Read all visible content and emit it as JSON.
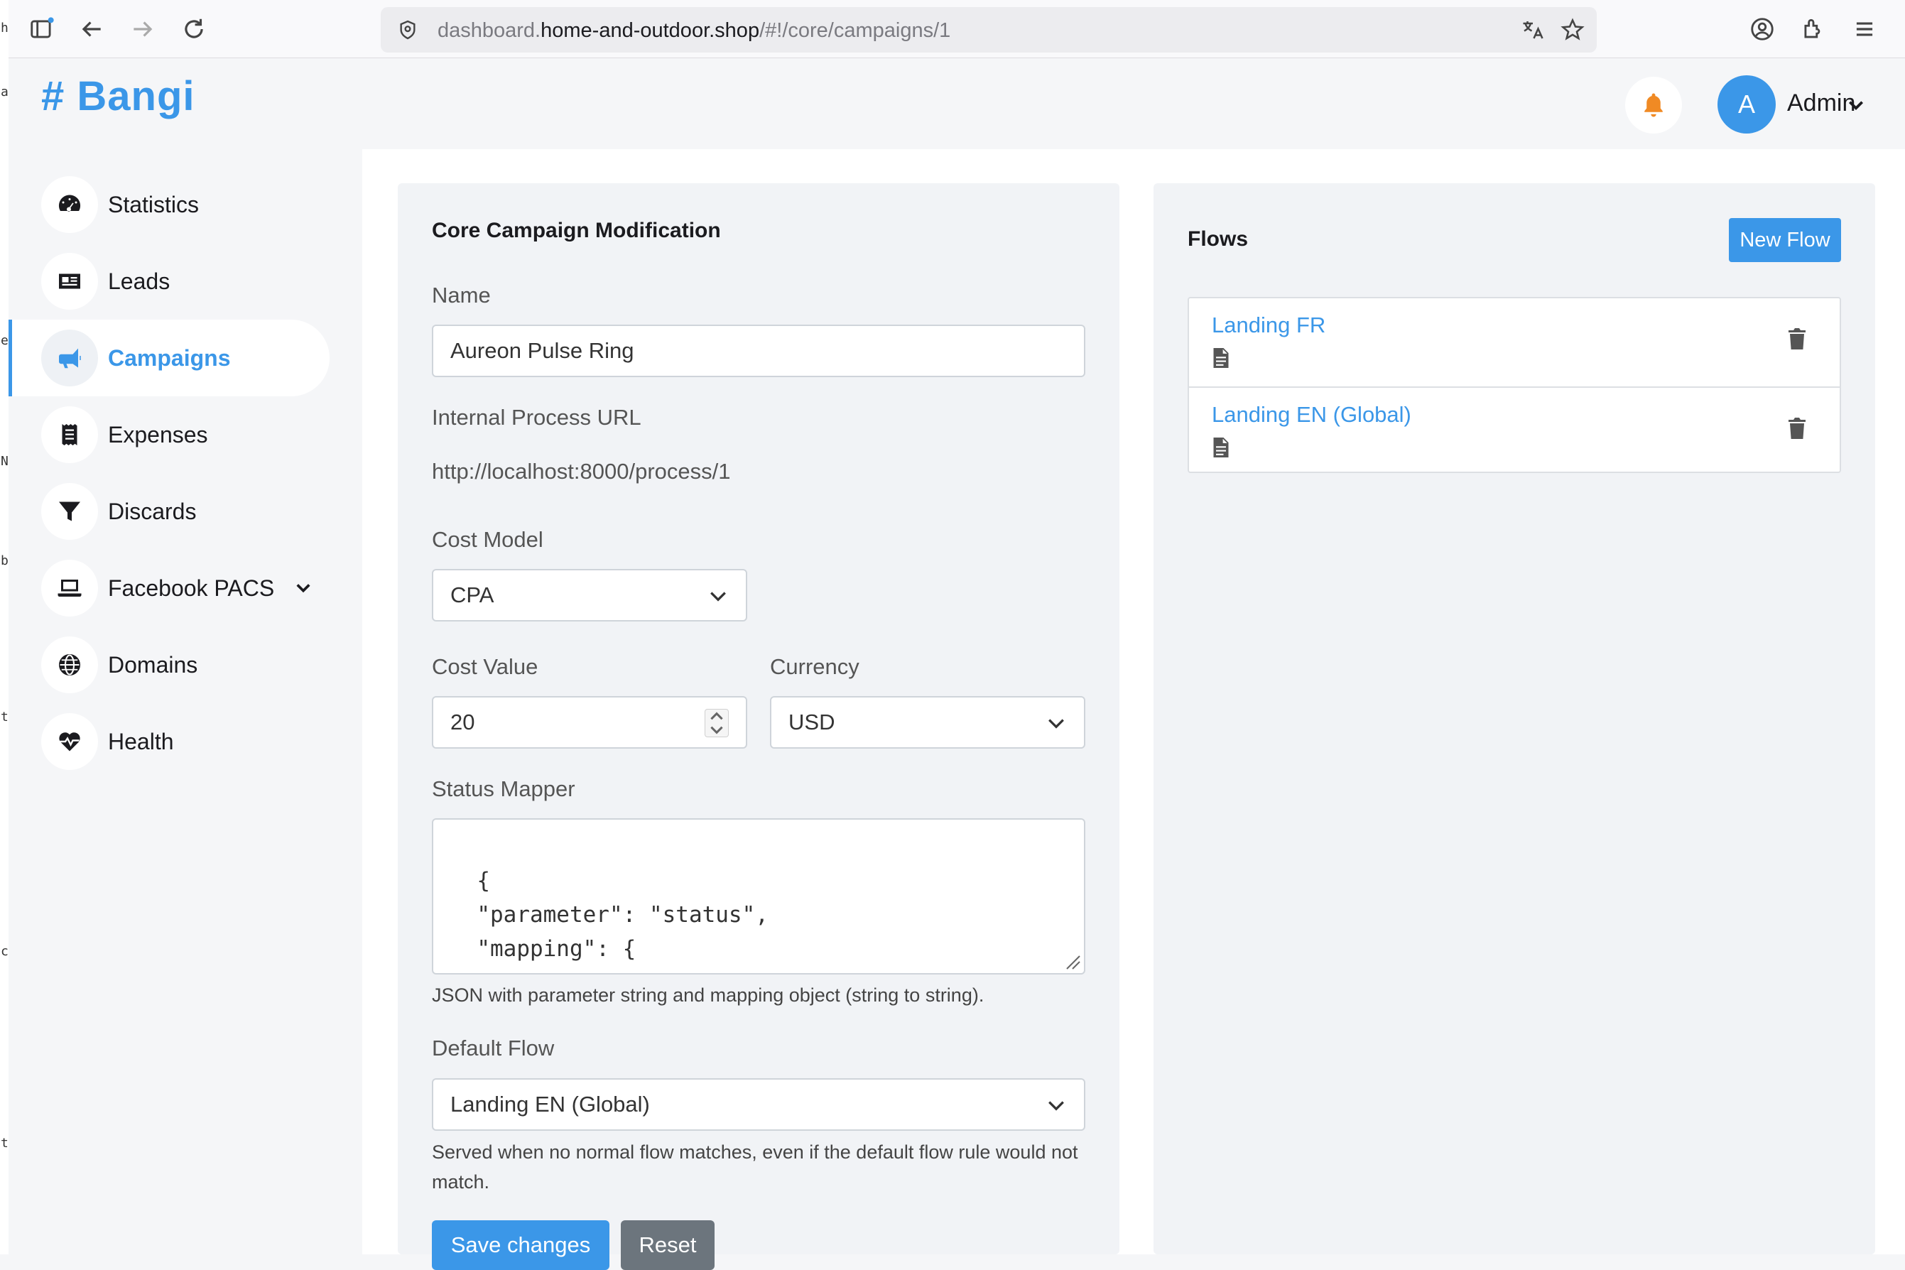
{
  "browser": {
    "url_prefix": "dashboard.",
    "url_host": "home-and-outdoor.shop",
    "url_path": "/#!/core/campaigns/1"
  },
  "brand": {
    "name": "# Bangi",
    "color": "#3b97e8"
  },
  "user": {
    "initial": "A",
    "name": "Admin"
  },
  "sidebar": {
    "items": [
      {
        "label": "Statistics",
        "icon": "gauge-icon"
      },
      {
        "label": "Leads",
        "icon": "id-card-icon"
      },
      {
        "label": "Campaigns",
        "icon": "megaphone-icon",
        "active": true
      },
      {
        "label": "Expenses",
        "icon": "receipt-icon"
      },
      {
        "label": "Discards",
        "icon": "filter-icon"
      },
      {
        "label": "Facebook PACS",
        "icon": "laptop-icon",
        "has_submenu": true
      },
      {
        "label": "Domains",
        "icon": "globe-icon"
      },
      {
        "label": "Health",
        "icon": "heartbeat-icon"
      }
    ]
  },
  "form": {
    "title": "Core Campaign Modification",
    "name_label": "Name",
    "name_value": "Aureon Pulse Ring",
    "url_label": "Internal Process URL",
    "url_value": "http://localhost:8000/process/1",
    "cost_model_label": "Cost Model",
    "cost_model_value": "CPA",
    "cost_value_label": "Cost Value",
    "cost_value": "20",
    "currency_label": "Currency",
    "currency_value": "USD",
    "status_mapper_label": "Status Mapper",
    "status_mapper_value": "{\n  \"parameter\": \"status\",\n  \"mapping\": {\n    \"done\": \"accept\",\n    \"failed\": \"reject\"\n  }\n}",
    "status_mapper_help": "JSON with parameter string and mapping object (string to string).",
    "default_flow_label": "Default Flow",
    "default_flow_value": "Landing EN (Global)",
    "default_flow_help": "Served when no normal flow matches, even if the default flow rule would not match.",
    "save_label": "Save changes",
    "reset_label": "Reset"
  },
  "flows": {
    "title": "Flows",
    "new_label": "New Flow",
    "items": [
      {
        "name": "Landing FR"
      },
      {
        "name": "Landing EN (Global)"
      }
    ]
  },
  "colors": {
    "accent": "#3b97e8",
    "bell": "#f08a24",
    "secondary": "#6c757d"
  }
}
